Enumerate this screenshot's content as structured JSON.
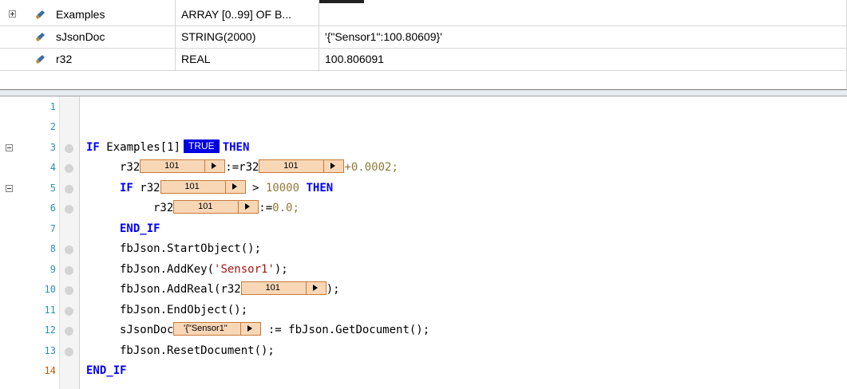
{
  "watch": {
    "rows": [
      {
        "name": "Examples",
        "type": "ARRAY [0..99] OF B...",
        "value": ""
      },
      {
        "name": "sJsonDoc",
        "type": "STRING(2000)",
        "value": "'{\"Sensor1\":100.80609}'"
      },
      {
        "name": "r32",
        "type": "REAL",
        "value": "100.806091"
      }
    ]
  },
  "editor": {
    "line_numbers": [
      "1",
      "2",
      "3",
      "4",
      "5",
      "6",
      "7",
      "8",
      "9",
      "10",
      "11",
      "12",
      "13",
      "14"
    ],
    "kw_if": "IF",
    "kw_then": "THEN",
    "kw_end_if": "END_IF",
    "examples_expr": "Examples[1]",
    "examples_monitor": "TRUE",
    "r32": "r32",
    "assign": ":=",
    "r32_monitor": "101",
    "plus_const": "+0.0002;",
    "gt": "> ",
    "gt_const": "10000",
    "zero_const": "0.0;",
    "call_start": "fbJson.StartObject();",
    "call_addkey_prefix": "fbJson.AddKey(",
    "call_addkey_arg": "'Sensor1'",
    "call_addkey_suffix": ");",
    "call_addreal_prefix": "fbJson.AddReal(",
    "call_addreal_suffix": ");",
    "call_end": "fbJson.EndObject();",
    "sjson": "sJsonDoc",
    "sjson_monitor": "'{\"Sensor1\"",
    "get_doc": " := fbJson.GetDocument();",
    "call_reset": "fbJson.ResetDocument();"
  }
}
